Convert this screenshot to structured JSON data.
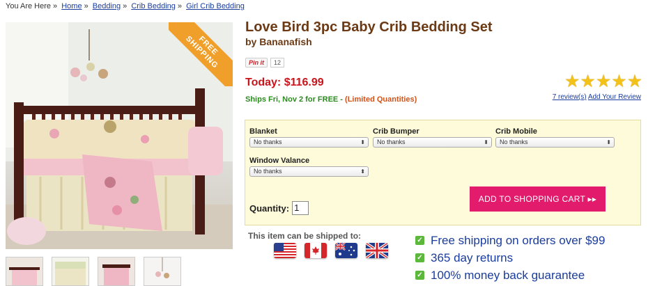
{
  "breadcrumb": {
    "prefix": "You Are Here",
    "separator": "»",
    "items": [
      "Home",
      "Bedding",
      "Crib Bedding",
      "Girl Crib Bedding"
    ]
  },
  "product": {
    "title": "Love Bird 3pc Baby Crib Bedding Set",
    "brand": "by Bananafish",
    "ribbon_text": "FREE\nSHIPPING",
    "price": "Today: $116.99",
    "ships_text": "Ships Fri, Nov 2 for FREE -",
    "limited_text": "(Limited Quantities)",
    "rating_out_of_5": 5,
    "reviews_link": "7 review(s)",
    "add_review_link": "Add Your Review"
  },
  "pinterest": {
    "label": "Pin it",
    "count": "12"
  },
  "options": {
    "blanket": {
      "label": "Blanket",
      "value": "No thanks"
    },
    "crib_bumper": {
      "label": "Crib Bumper",
      "value": "No thanks"
    },
    "crib_mobile": {
      "label": "Crib Mobile",
      "value": "No thanks"
    },
    "window_valance": {
      "label": "Window Valance",
      "value": "No thanks"
    }
  },
  "quantity": {
    "label": "Quantity:",
    "value": "1"
  },
  "cart_button": "ADD TO SHOPPING CART ▸▸",
  "shipping": {
    "label": "This item can be shipped to:",
    "countries": [
      "us-flag-icon",
      "canada-flag-icon",
      "australia-flag-icon",
      "uk-flag-icon"
    ]
  },
  "benefits": [
    "Free shipping on orders over $99",
    "365 day returns",
    "100% money back guarantee"
  ],
  "colors": {
    "title_brown": "#6b3a15",
    "price_red": "#c8151b",
    "ships_green": "#2a8a1e",
    "cart_pink": "#e21b6d",
    "options_bg": "#fdfbd9",
    "link_blue": "#1a3c9c",
    "ribbon_orange": "#f0a02a"
  }
}
